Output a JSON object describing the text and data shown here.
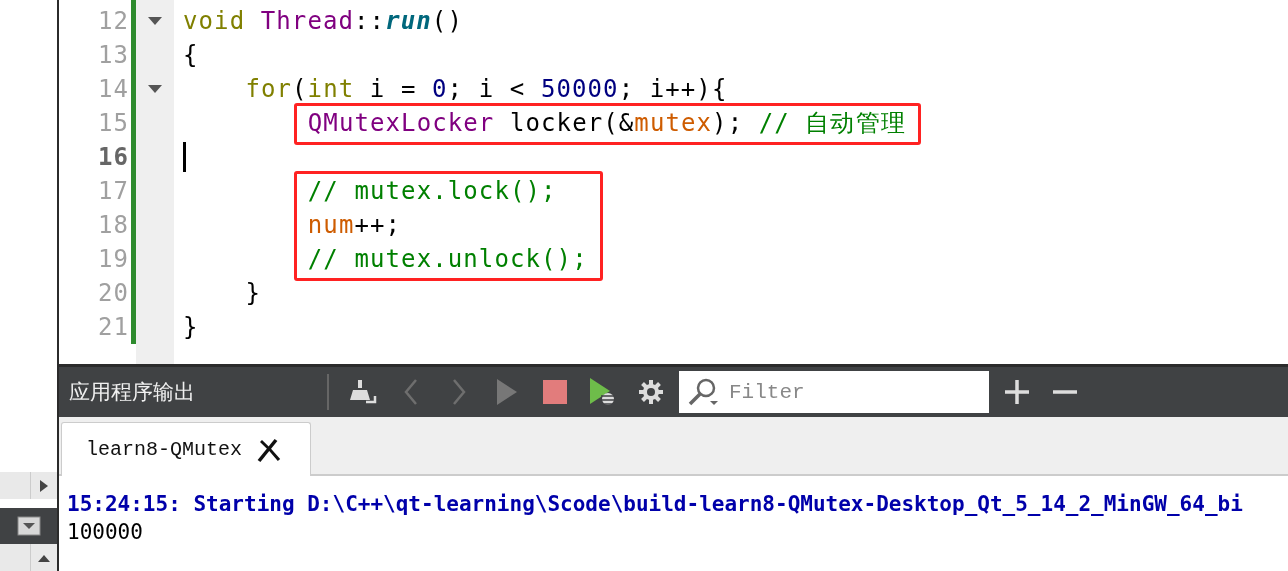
{
  "editor": {
    "lines": [
      {
        "number": "12",
        "current": false,
        "foldable": true,
        "boxed": false,
        "tokens": [
          {
            "kind": "keyword",
            "text": "void"
          },
          {
            "kind": "type",
            "text": " Thread"
          },
          {
            "kind": "plain",
            "text": "::"
          },
          {
            "kind": "func",
            "text": "run"
          },
          {
            "kind": "plain",
            "text": "()"
          }
        ]
      },
      {
        "number": "13",
        "current": false,
        "foldable": false,
        "boxed": false,
        "tokens": [
          {
            "kind": "plain",
            "text": "{"
          }
        ],
        "children": [
          {
            "number": "14",
            "current": false,
            "foldable": true,
            "boxed": false,
            "tokens": [
              {
                "kind": "keyword",
                "text": "for"
              },
              {
                "kind": "plain",
                "text": "("
              },
              {
                "kind": "keyword",
                "text": "int"
              },
              {
                "kind": "plain",
                "text": " i = "
              },
              {
                "kind": "number",
                "text": "0"
              },
              {
                "kind": "plain",
                "text": "; i < "
              },
              {
                "kind": "number",
                "text": "50000"
              },
              {
                "kind": "plain",
                "text": "; i++){"
              }
            ],
            "children": [
              {
                "number": "15",
                "current": false,
                "foldable": false,
                "boxed": true,
                "tokens": [
                  {
                    "kind": "type",
                    "text": "QMutexLocker"
                  },
                  {
                    "kind": "plain",
                    "text": " locker(&"
                  },
                  {
                    "kind": "member",
                    "text": "mutex"
                  },
                  {
                    "kind": "plain",
                    "text": "); "
                  },
                  {
                    "kind": "comment",
                    "text": "// 自动管理"
                  }
                ]
              },
              {
                "number": "16",
                "current": true,
                "foldable": false,
                "boxed": false
              },
              {
                "number": "17",
                "current": false,
                "foldable": false,
                "boxed": true,
                "tokens": [
                  {
                    "kind": "comment",
                    "text": "// mutex.lock();"
                  }
                ]
              },
              {
                "number": "18",
                "current": false,
                "foldable": false,
                "boxed": true,
                "tokens": [
                  {
                    "kind": "member",
                    "text": "num"
                  },
                  {
                    "kind": "plain",
                    "text": "++;"
                  }
                ]
              },
              {
                "number": "19",
                "current": false,
                "foldable": false,
                "boxed": true,
                "tokens": [
                  {
                    "kind": "comment",
                    "text": "// mutex.unlock();"
                  }
                ]
              }
            ]
          },
          {
            "number": "20",
            "current": false,
            "foldable": false,
            "boxed": false,
            "tokens": [
              {
                "kind": "plain",
                "text": "}"
              }
            ]
          }
        ]
      },
      {
        "number": "21",
        "current": false,
        "foldable": false,
        "boxed": false,
        "tokens": [
          {
            "kind": "plain",
            "text": "}"
          }
        ]
      }
    ]
  },
  "output_pane": {
    "title": "应用程序输出",
    "tools": [
      {
        "kind": "clean",
        "disabled": false
      },
      {
        "kind": "prev",
        "disabled": true
      },
      {
        "kind": "next",
        "disabled": true
      },
      {
        "kind": "run",
        "disabled": true
      },
      {
        "kind": "stop",
        "disabled": false
      },
      {
        "kind": "debug",
        "disabled": false
      },
      {
        "kind": "settings",
        "disabled": false
      }
    ],
    "filter": {
      "placeholder": "Filter"
    },
    "zoom_tools": [
      {
        "kind": "zoom-in"
      },
      {
        "kind": "zoom-out"
      }
    ],
    "tabs": [
      {
        "label": "learn8-QMutex",
        "selected": true
      }
    ],
    "lines": [
      {
        "kind": "status",
        "text": "15:24:15: Starting D:\\C++\\qt-learning\\Scode\\build-learn8-QMutex-Desktop_Qt_5_14_2_MinGW_64_bi"
      },
      {
        "kind": "stdout",
        "text": "100000"
      }
    ]
  }
}
